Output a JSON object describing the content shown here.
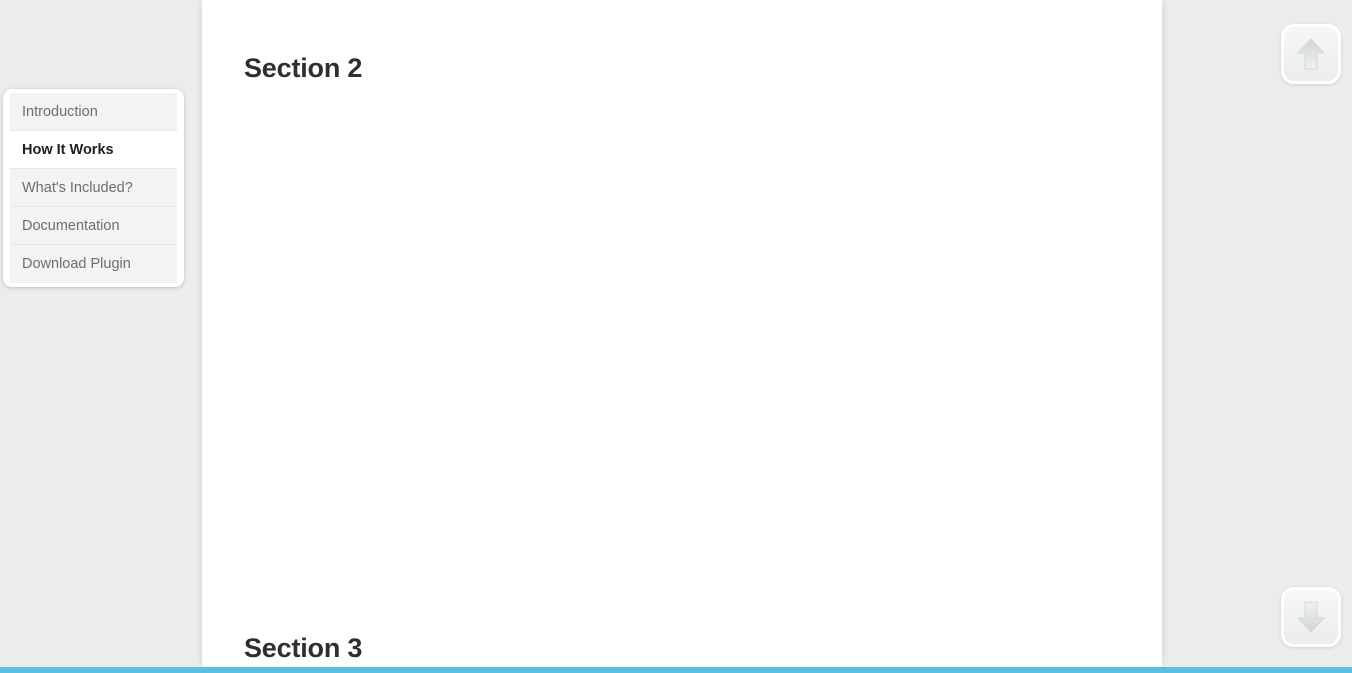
{
  "colors": {
    "page_background": "#ececec",
    "panel_background": "#ffffff",
    "accent_bar": "#5bc0de",
    "heading_text": "#2f2f2f",
    "nav_item_text": "#6e6e6e",
    "nav_item_active_text": "#1f1f1f",
    "nav_item_background": "#f3f3f3",
    "nav_item_active_background": "#ffffff",
    "arrow_glyph": "#d8dcdc"
  },
  "sidebar": {
    "items": [
      {
        "label": "Introduction",
        "active": false
      },
      {
        "label": "How It Works",
        "active": true
      },
      {
        "label": "What's Included?",
        "active": false
      },
      {
        "label": "Documentation",
        "active": false
      },
      {
        "label": "Download Plugin",
        "active": false
      }
    ]
  },
  "main": {
    "sections": [
      {
        "heading": "Section 2"
      },
      {
        "heading": "Section 3"
      }
    ]
  },
  "scroll_controls": {
    "up": {
      "icon": "arrow-up-icon",
      "label": "Scroll up"
    },
    "down": {
      "icon": "arrow-down-icon",
      "label": "Scroll down"
    }
  }
}
